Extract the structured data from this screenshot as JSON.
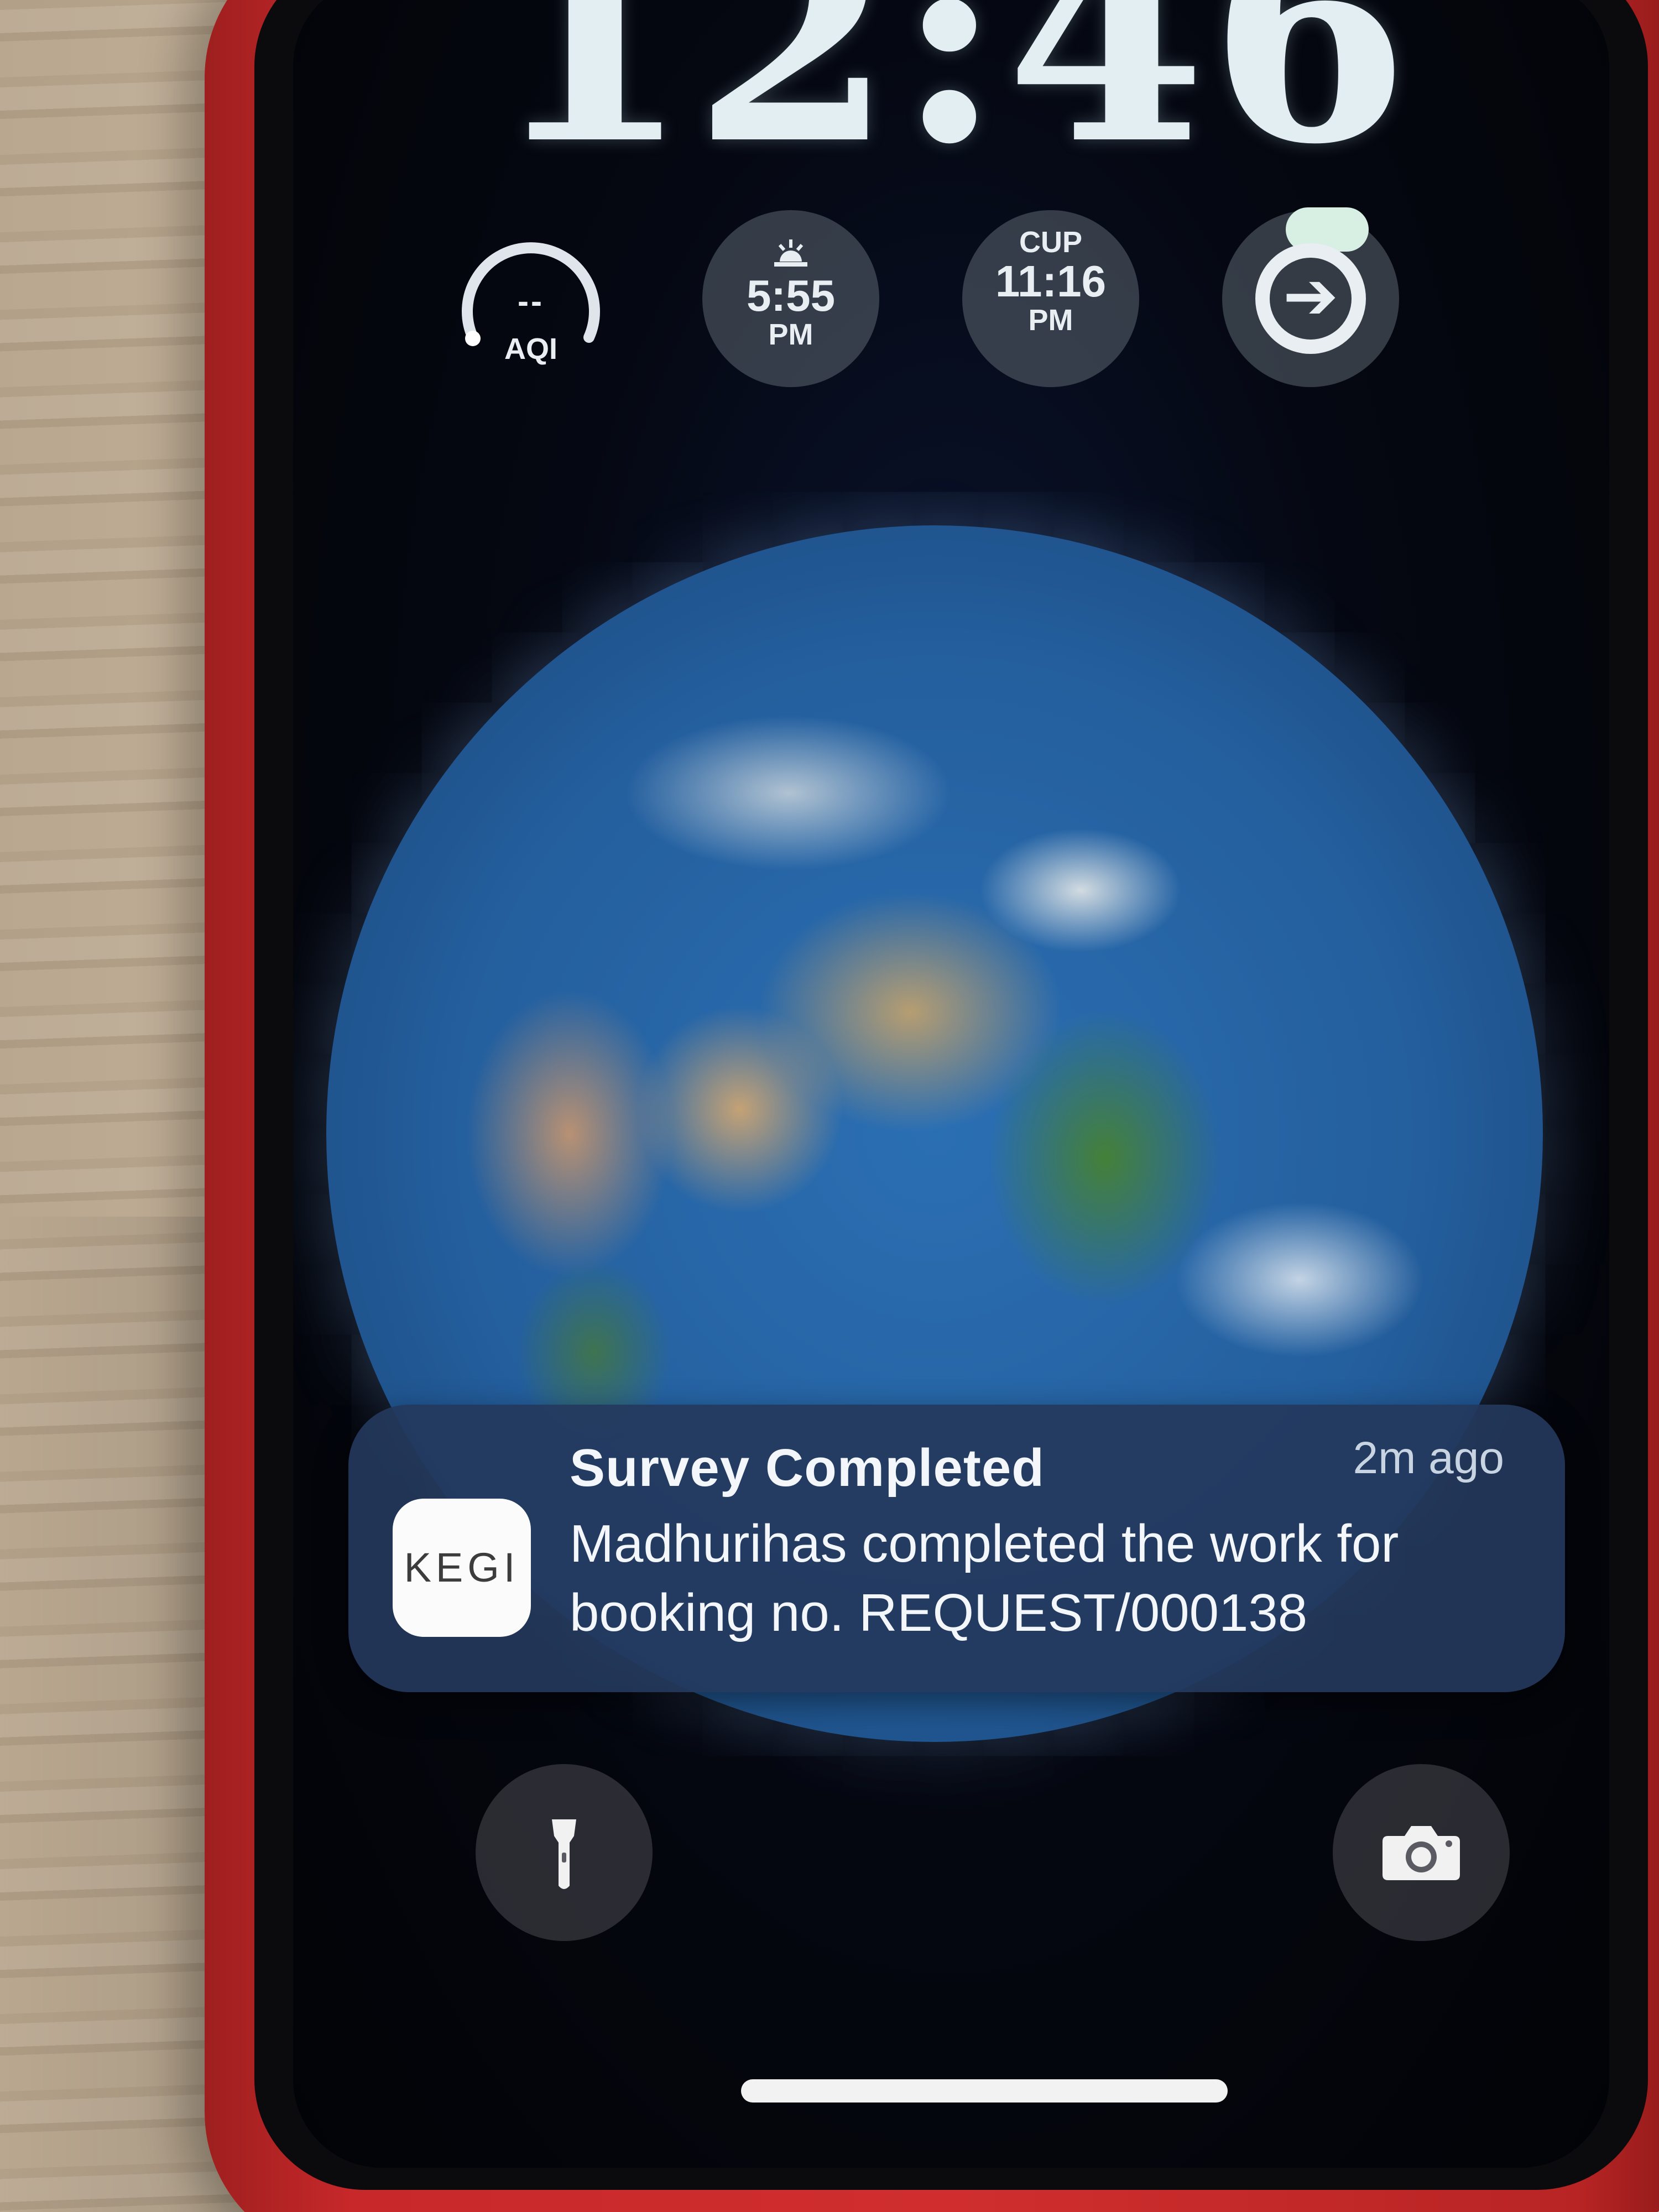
{
  "lockscreen": {
    "time": "12:46"
  },
  "widgets": {
    "aqi": {
      "value": "--",
      "label": "AQI"
    },
    "sunset": {
      "time": "5:55",
      "period": "PM"
    },
    "cup": {
      "label": "CUP",
      "time": "11:16",
      "period": "PM"
    },
    "arrow": {
      "icon": "arrow-right-icon"
    }
  },
  "notification": {
    "app_icon_text": "KEGI",
    "title": "Survey Completed",
    "time_ago": "2m ago",
    "body": "Madhurihas completed the work for booking no. REQUEST/000138"
  },
  "quick_actions": {
    "flashlight_icon": "flashlight-icon",
    "camera_icon": "camera-icon"
  },
  "colors": {
    "case": "#c8282a",
    "notification_bg": "#24385c",
    "clock": "#e3eef2"
  }
}
